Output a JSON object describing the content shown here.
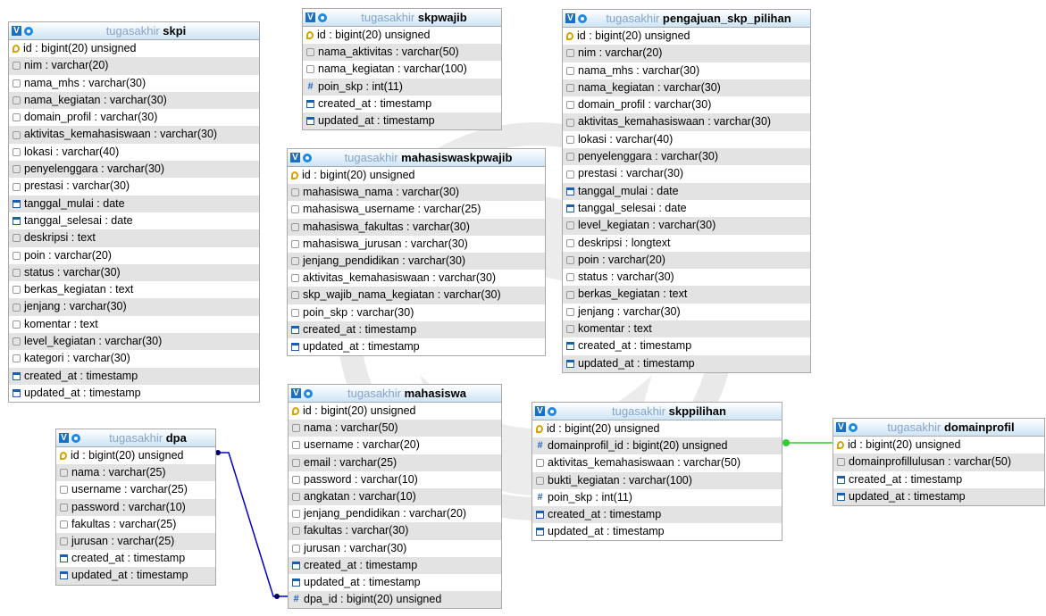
{
  "db_name": "tugasakhir",
  "v_icon": "V",
  "num_glyph": "#",
  "colors": {
    "header_top": "#ffffff",
    "header_bottom": "#cde4f5",
    "stripe": "#e3e3e3",
    "fk_line_blue": "#0000cc",
    "fk_line_green": "#33cc33"
  },
  "tables": [
    {
      "name": "skpi",
      "fields": [
        {
          "text": "id : bigint(20) unsigned",
          "icon": "key-icon"
        },
        {
          "text": "nim : varchar(20)",
          "icon": "string-icon"
        },
        {
          "text": "nama_mhs : varchar(30)",
          "icon": "string-icon"
        },
        {
          "text": "nama_kegiatan : varchar(30)",
          "icon": "string-icon"
        },
        {
          "text": "domain_profil : varchar(30)",
          "icon": "string-icon"
        },
        {
          "text": "aktivitas_kemahasiswaan : varchar(30)",
          "icon": "string-icon"
        },
        {
          "text": "lokasi : varchar(40)",
          "icon": "string-icon"
        },
        {
          "text": "penyelenggara : varchar(30)",
          "icon": "string-icon"
        },
        {
          "text": "prestasi : varchar(30)",
          "icon": "string-icon"
        },
        {
          "text": "tanggal_mulai : date",
          "icon": "date-icon"
        },
        {
          "text": "tanggal_selesai : date",
          "icon": "date-icon"
        },
        {
          "text": "deskripsi : text",
          "icon": "string-icon"
        },
        {
          "text": "poin : varchar(20)",
          "icon": "string-icon"
        },
        {
          "text": "status : varchar(30)",
          "icon": "string-icon"
        },
        {
          "text": "berkas_kegiatan : text",
          "icon": "string-icon"
        },
        {
          "text": "jenjang : varchar(30)",
          "icon": "string-icon"
        },
        {
          "text": "komentar : text",
          "icon": "string-icon"
        },
        {
          "text": "level_kegiatan : varchar(30)",
          "icon": "string-icon"
        },
        {
          "text": "kategori : varchar(30)",
          "icon": "string-icon"
        },
        {
          "text": "created_at : timestamp",
          "icon": "date-icon"
        },
        {
          "text": "updated_at : timestamp",
          "icon": "date-icon"
        }
      ]
    },
    {
      "name": "skpwajib",
      "fields": [
        {
          "text": "id : bigint(20) unsigned",
          "icon": "key-icon"
        },
        {
          "text": "nama_aktivitas : varchar(50)",
          "icon": "string-icon"
        },
        {
          "text": "nama_kegiatan : varchar(100)",
          "icon": "string-icon"
        },
        {
          "text": "poin_skp : int(11)",
          "icon": "number-icon"
        },
        {
          "text": "created_at : timestamp",
          "icon": "date-icon"
        },
        {
          "text": "updated_at : timestamp",
          "icon": "date-icon"
        }
      ]
    },
    {
      "name": "mahasiswaskpwajib",
      "fields": [
        {
          "text": "id : bigint(20) unsigned",
          "icon": "key-icon"
        },
        {
          "text": "mahasiswa_nama : varchar(30)",
          "icon": "string-icon"
        },
        {
          "text": "mahasiswa_username : varchar(25)",
          "icon": "string-icon"
        },
        {
          "text": "mahasiswa_fakultas : varchar(30)",
          "icon": "string-icon"
        },
        {
          "text": "mahasiswa_jurusan : varchar(30)",
          "icon": "string-icon"
        },
        {
          "text": "jenjang_pendidikan : varchar(30)",
          "icon": "string-icon"
        },
        {
          "text": "aktivitas_kemahasiswaan : varchar(30)",
          "icon": "string-icon"
        },
        {
          "text": "skp_wajib_nama_kegiatan : varchar(30)",
          "icon": "string-icon"
        },
        {
          "text": "poin_skp : varchar(30)",
          "icon": "string-icon"
        },
        {
          "text": "created_at : timestamp",
          "icon": "date-icon"
        },
        {
          "text": "updated_at : timestamp",
          "icon": "date-icon"
        }
      ]
    },
    {
      "name": "pengajuan_skp_pilihan",
      "fields": [
        {
          "text": "id : bigint(20) unsigned",
          "icon": "key-icon"
        },
        {
          "text": "nim : varchar(20)",
          "icon": "string-icon"
        },
        {
          "text": "nama_mhs : varchar(30)",
          "icon": "string-icon"
        },
        {
          "text": "nama_kegiatan : varchar(30)",
          "icon": "string-icon"
        },
        {
          "text": "domain_profil : varchar(30)",
          "icon": "string-icon"
        },
        {
          "text": "aktivitas_kemahasiswaan : varchar(30)",
          "icon": "string-icon"
        },
        {
          "text": "lokasi : varchar(40)",
          "icon": "string-icon"
        },
        {
          "text": "penyelenggara : varchar(30)",
          "icon": "string-icon"
        },
        {
          "text": "prestasi : varchar(30)",
          "icon": "string-icon"
        },
        {
          "text": "tanggal_mulai : date",
          "icon": "date-icon"
        },
        {
          "text": "tanggal_selesai : date",
          "icon": "date-icon"
        },
        {
          "text": "level_kegiatan : varchar(30)",
          "icon": "string-icon"
        },
        {
          "text": "deskripsi : longtext",
          "icon": "string-icon"
        },
        {
          "text": "poin : varchar(20)",
          "icon": "string-icon"
        },
        {
          "text": "status : varchar(30)",
          "icon": "string-icon"
        },
        {
          "text": "berkas_kegiatan : text",
          "icon": "string-icon"
        },
        {
          "text": "jenjang : varchar(30)",
          "icon": "string-icon"
        },
        {
          "text": "komentar : text",
          "icon": "string-icon"
        },
        {
          "text": "created_at : timestamp",
          "icon": "date-icon"
        },
        {
          "text": "updated_at : timestamp",
          "icon": "date-icon"
        }
      ]
    },
    {
      "name": "dpa",
      "fields": [
        {
          "text": "id : bigint(20) unsigned",
          "icon": "key-icon"
        },
        {
          "text": "nama : varchar(25)",
          "icon": "string-icon"
        },
        {
          "text": "username : varchar(25)",
          "icon": "string-icon"
        },
        {
          "text": "password : varchar(10)",
          "icon": "string-icon"
        },
        {
          "text": "fakultas : varchar(25)",
          "icon": "string-icon"
        },
        {
          "text": "jurusan : varchar(25)",
          "icon": "string-icon"
        },
        {
          "text": "created_at : timestamp",
          "icon": "date-icon"
        },
        {
          "text": "updated_at : timestamp",
          "icon": "date-icon"
        }
      ]
    },
    {
      "name": "mahasiswa",
      "fields": [
        {
          "text": "id : bigint(20) unsigned",
          "icon": "key-icon"
        },
        {
          "text": "nama : varchar(50)",
          "icon": "string-icon"
        },
        {
          "text": "username : varchar(20)",
          "icon": "string-icon"
        },
        {
          "text": "email : varchar(25)",
          "icon": "string-icon"
        },
        {
          "text": "password : varchar(10)",
          "icon": "string-icon"
        },
        {
          "text": "angkatan : varchar(10)",
          "icon": "string-icon"
        },
        {
          "text": "jenjang_pendidikan : varchar(20)",
          "icon": "string-icon"
        },
        {
          "text": "fakultas : varchar(30)",
          "icon": "string-icon"
        },
        {
          "text": "jurusan : varchar(30)",
          "icon": "string-icon"
        },
        {
          "text": "created_at : timestamp",
          "icon": "date-icon"
        },
        {
          "text": "updated_at : timestamp",
          "icon": "date-icon"
        },
        {
          "text": "dpa_id : bigint(20) unsigned",
          "icon": "number-icon"
        }
      ]
    },
    {
      "name": "skppilihan",
      "fields": [
        {
          "text": "id : bigint(20) unsigned",
          "icon": "key-icon"
        },
        {
          "text": "domainprofil_id : bigint(20) unsigned",
          "icon": "number-icon"
        },
        {
          "text": "aktivitas_kemahasiswaan : varchar(50)",
          "icon": "string-icon"
        },
        {
          "text": "bukti_kegiatan : varchar(100)",
          "icon": "string-icon"
        },
        {
          "text": "poin_skp : int(11)",
          "icon": "number-icon"
        },
        {
          "text": "created_at : timestamp",
          "icon": "date-icon"
        },
        {
          "text": "updated_at : timestamp",
          "icon": "date-icon"
        }
      ]
    },
    {
      "name": "domainprofil",
      "fields": [
        {
          "text": "id : bigint(20) unsigned",
          "icon": "key-icon"
        },
        {
          "text": "domainprofillulusan : varchar(50)",
          "icon": "string-icon"
        },
        {
          "text": "created_at : timestamp",
          "icon": "date-icon"
        },
        {
          "text": "updated_at : timestamp",
          "icon": "date-icon"
        }
      ]
    }
  ]
}
